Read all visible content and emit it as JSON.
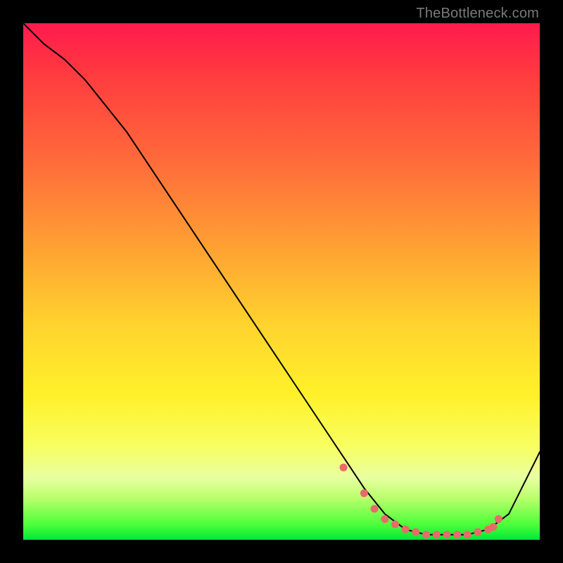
{
  "watermark": "TheBottleneck.com",
  "chart_data": {
    "type": "line",
    "title": "",
    "xlabel": "",
    "ylabel": "",
    "xlim": [
      0,
      100
    ],
    "ylim": [
      0,
      100
    ],
    "series": [
      {
        "name": "curve",
        "x": [
          0,
          4,
          8,
          12,
          20,
          28,
          36,
          44,
          52,
          60,
          66,
          70,
          74,
          78,
          82,
          86,
          90,
          94,
          100
        ],
        "y": [
          100,
          96,
          93,
          89,
          79,
          67,
          55,
          43,
          31,
          19,
          10,
          5,
          2,
          1,
          1,
          1,
          2,
          5,
          17
        ]
      }
    ],
    "markers": {
      "name": "dots",
      "x": [
        62,
        66,
        68,
        70,
        72,
        74,
        76,
        78,
        80,
        82,
        84,
        86,
        88,
        90,
        91,
        92
      ],
      "y": [
        14,
        9,
        6,
        4,
        3,
        2,
        1.5,
        1,
        1,
        1,
        1,
        1,
        1.5,
        2,
        2.5,
        4
      ]
    },
    "colors": {
      "curve": "#000000",
      "marker": "#e86a6a"
    }
  }
}
